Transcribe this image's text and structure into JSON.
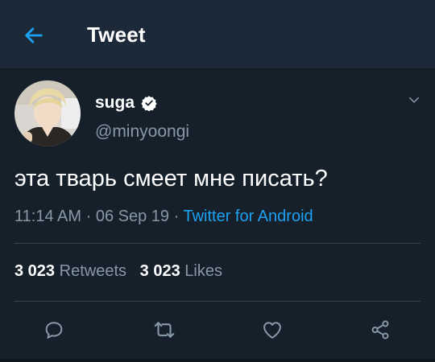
{
  "header": {
    "title": "Tweet",
    "back_icon": "arrow-left-icon"
  },
  "tweet": {
    "author": {
      "display_name": "suga",
      "handle": "@minyoongi",
      "verified_icon": "verified-badge-icon",
      "avatar": "avatar"
    },
    "menu_icon": "chevron-down-icon",
    "text": "эта тварь смеет мне писать?",
    "time": "11:14 AM",
    "separator": "·",
    "date": "06 Sep 19",
    "source": "Twitter for Android",
    "retweets_count": "3 023",
    "retweets_label": "Retweets",
    "likes_count": "3 023",
    "likes_label": "Likes"
  },
  "actions": {
    "reply_icon": "reply-icon",
    "retweet_icon": "retweet-icon",
    "like_icon": "heart-icon",
    "share_icon": "share-icon"
  },
  "colors": {
    "background": "#15202b",
    "header_background": "#1c2938",
    "accent": "#1da1f2",
    "secondary_text": "#8899a6",
    "divider": "#38444d"
  }
}
